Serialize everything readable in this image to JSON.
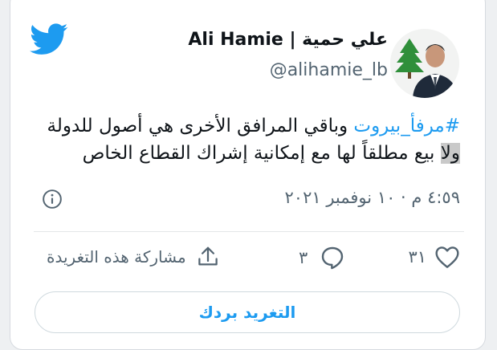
{
  "tweet": {
    "display_name": "Ali Hamie | علي حمية",
    "handle": "@alihamie_lb",
    "text": {
      "hashtag": "#مرفأ_بيروت",
      "line1_rest": " وباقي المرافق الأخرى هي أصول للدولة ",
      "highlight": "ولا",
      "line2_rest": " بيع مطلقاً لها مع إمكانية إشراك القطاع الخاص"
    },
    "timestamp": "٤:٥٩ م · ١٠ نوفمبر ٢٠٢١"
  },
  "actions": {
    "like_count": "٣١",
    "reply_count": "٣",
    "share_label": "مشاركة هذه التغريدة"
  },
  "reply_button_label": "التغريد بردك",
  "colors": {
    "accent": "#1d9bf0",
    "secondary_text": "#536471",
    "highlight_bg": "#c9c9c9"
  },
  "icons": {
    "logo": "twitter-bird-icon",
    "info": "info-icon",
    "like": "heart-icon",
    "reply": "reply-bubble-icon",
    "share": "share-icon"
  }
}
